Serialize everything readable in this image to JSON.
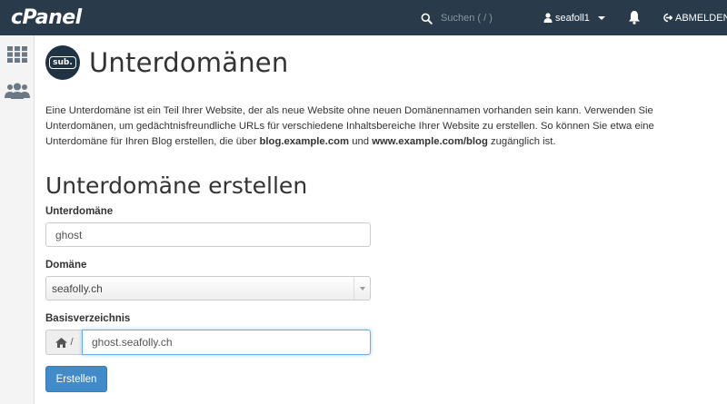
{
  "header": {
    "logo": "cPanel",
    "search_placeholder": "Suchen ( / )",
    "username": "seafoll1",
    "logout_label": "ABMELDEN"
  },
  "sidebar": {
    "items": [
      {
        "icon": "grid-icon"
      },
      {
        "icon": "users-icon"
      }
    ]
  },
  "page": {
    "icon_text": "sub.",
    "title": "Unterdomänen",
    "description": {
      "part1": "Eine Unterdomäne ist ein Teil Ihrer Website, der als neue Website ohne neuen Domänennamen vorhanden sein kann. Verwenden Sie Unterdomänen, um gedächtnisfreundliche URLs für verschiedene Inhaltsbereiche Ihrer Website zu erstellen. So können Sie etwa eine Unterdomäne für Ihren Blog erstellen, die über ",
      "link1": "blog.example.com",
      "part2": " und ",
      "link2": "www.example.com/blog",
      "part3": " zugänglich ist."
    }
  },
  "form": {
    "section_title": "Unterdomäne erstellen",
    "subdomain_label": "Unterdomäne",
    "subdomain_value": "ghost",
    "domain_label": "Domäne",
    "domain_value": "seafolly.ch",
    "docroot_label": "Basisverzeichnis",
    "docroot_prefix": "/",
    "docroot_value": "ghost.seafolly.ch",
    "submit_label": "Erstellen"
  },
  "colors": {
    "topbar": "#293a4a",
    "primary_button": "#428bca"
  }
}
